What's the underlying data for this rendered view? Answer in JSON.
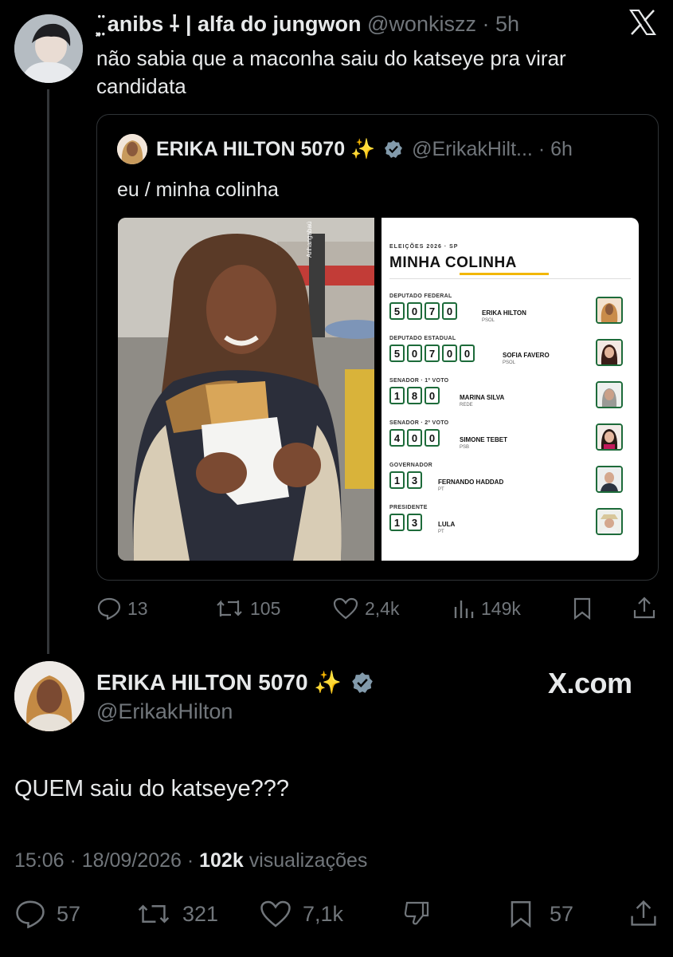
{
  "reply_tweet": {
    "display_name": "⸼̤̈ anibs ⸸ | alfa do jungwon",
    "handle": "@wonkiszz",
    "time": "· 5h",
    "text_line1": "não sabia que a maconha saiu do katseye pra virar",
    "text_line2": "candidata",
    "actions": {
      "replies": "13",
      "retweets": "105",
      "likes": "2,4k",
      "views": "149k"
    }
  },
  "quoted_tweet": {
    "display_name": "ERIKA HILTON 5070 ✨",
    "handle": "@ErikakHilt...",
    "time": "· 6h",
    "text": "eu / minha colinha",
    "photo_sign": "Anhangabaú",
    "ballot": {
      "kicker": "ELEIÇÕES 2026 · SP",
      "title": "MINHA COLINHA",
      "offices": [
        {
          "label": "DEPUTADO FEDERAL",
          "digits": [
            "5",
            "0",
            "7",
            "0"
          ],
          "name": "ERIKA HILTON",
          "party": "PSOL"
        },
        {
          "label": "DEPUTADO ESTADUAL",
          "digits": [
            "5",
            "0",
            "7",
            "0",
            "0"
          ],
          "name": "SOFIA FAVERO",
          "party": "PSOL"
        },
        {
          "label": "SENADOR · 1º VOTO",
          "digits": [
            "1",
            "8",
            "0"
          ],
          "name": "MARINA SILVA",
          "party": "REDE"
        },
        {
          "label": "SENADOR · 2º VOTO",
          "digits": [
            "4",
            "0",
            "0"
          ],
          "name": "SIMONE TEBET",
          "party": "PSB"
        },
        {
          "label": "GOVERNADOR",
          "digits": [
            "1",
            "3"
          ],
          "name": "FERNANDO HADDAD",
          "party": "PT"
        },
        {
          "label": "PRESIDENTE",
          "digits": [
            "1",
            "3"
          ],
          "name": "LULA",
          "party": "PT"
        }
      ]
    }
  },
  "main_tweet": {
    "display_name": "ERIKA HILTON 5070 ✨",
    "handle": "@ErikakHilton",
    "text": "QUEM saiu do katseye???",
    "timestamp": "15:06 · 18/09/2026 ·",
    "views_count": "102k",
    "views_label": "visualizações",
    "actions": {
      "replies": "57",
      "retweets": "321",
      "likes": "7,1k",
      "bookmarks": "57"
    }
  },
  "watermark": "X.com",
  "colors": {
    "background": "#000000",
    "text": "#e7e9ea",
    "muted": "#71767b",
    "verified": "#829aab",
    "ballot_green": "#1d6b3a",
    "ballot_accent": "#f2b705"
  }
}
